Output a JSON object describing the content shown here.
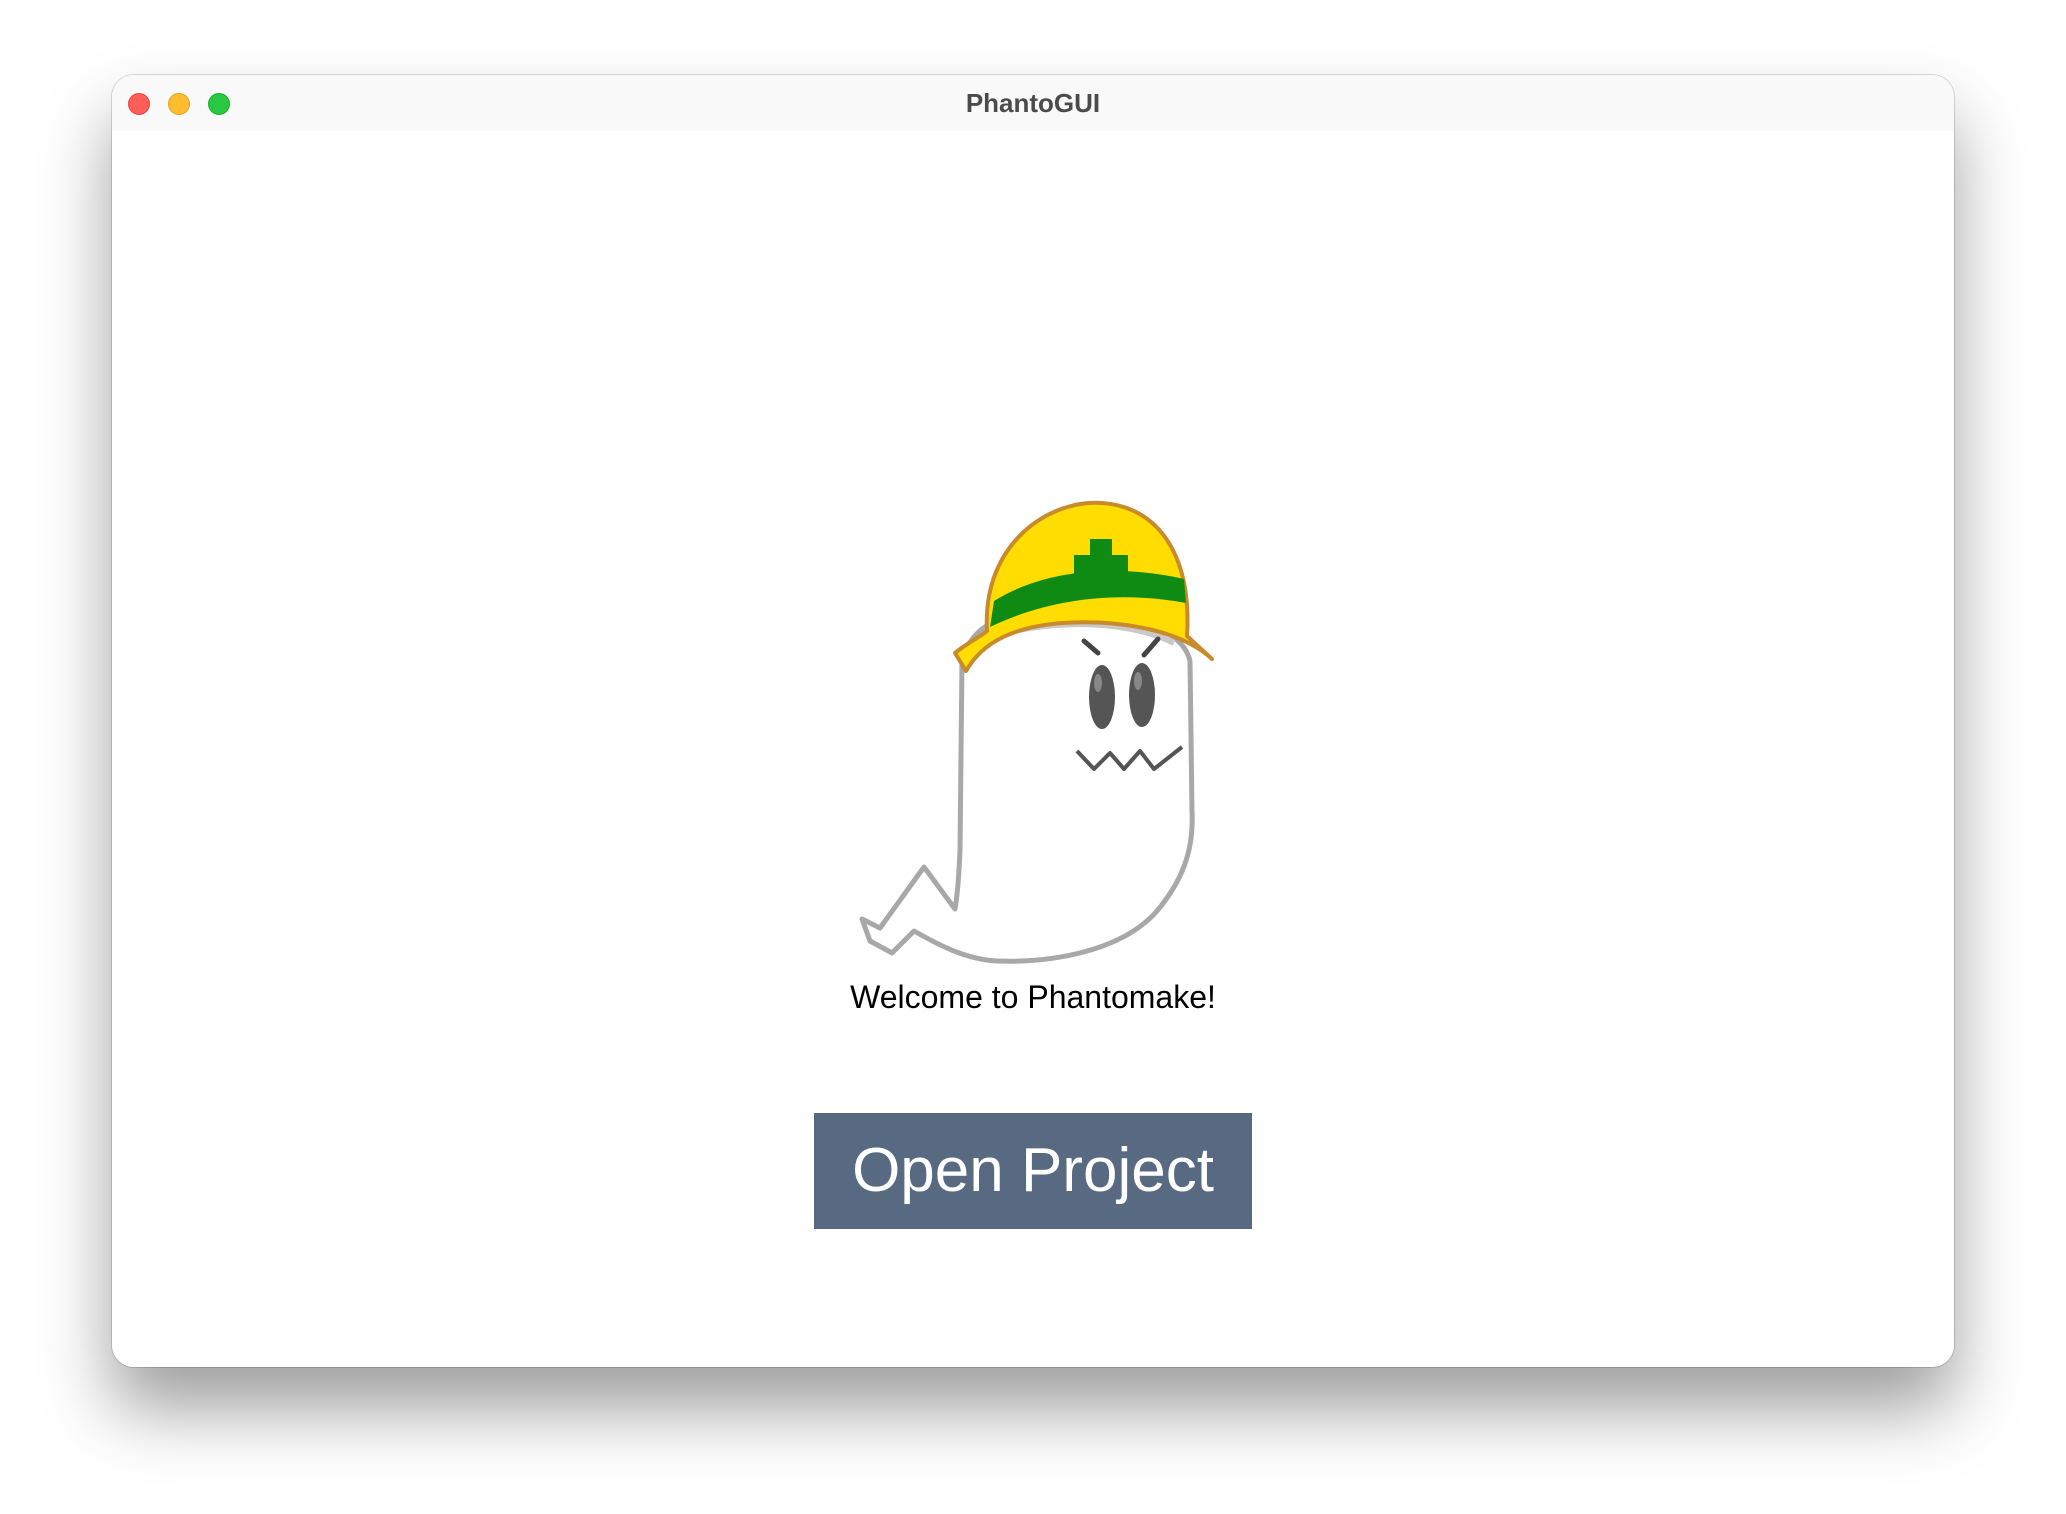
{
  "window": {
    "title": "PhantoGUI",
    "controls": [
      "close",
      "minimize",
      "zoom"
    ]
  },
  "main": {
    "mascot_icon": "ghost-with-hard-hat",
    "welcome_text": "Welcome to Phantomake!",
    "open_project_label": "Open Project"
  },
  "colors": {
    "button_bg": "#586982",
    "helmet": "#ffdd00",
    "helmet_band": "#0f8a12"
  }
}
